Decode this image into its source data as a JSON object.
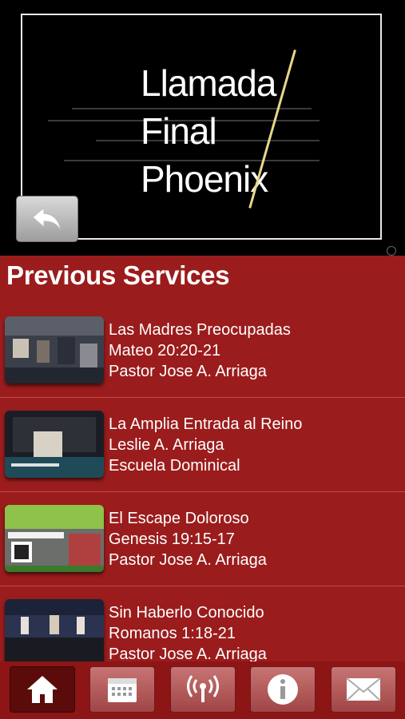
{
  "hero": {
    "title_lines": [
      "Llamada",
      "Final",
      "Phoenix"
    ]
  },
  "section": {
    "title": "Previous Services"
  },
  "services": [
    {
      "title": "Las Madres Preocupadas",
      "reference": "Mateo 20:20-21",
      "speaker": "Pastor Jose A. Arriaga"
    },
    {
      "title": "La Amplia Entrada al Reino",
      "reference": "Leslie A. Arriaga",
      "speaker": "Escuela Dominical"
    },
    {
      "title": "El Escape Doloroso",
      "reference": "Genesis 19:15-17",
      "speaker": "Pastor Jose A. Arriaga"
    },
    {
      "title": "Sin Haberlo Conocido",
      "reference": "Romanos 1:18-21",
      "speaker": "Pastor Jose A. Arriaga"
    }
  ],
  "tabs": [
    {
      "name": "home-icon"
    },
    {
      "name": "calendar-icon"
    },
    {
      "name": "broadcast-icon"
    },
    {
      "name": "info-icon"
    },
    {
      "name": "mail-icon"
    }
  ],
  "colors": {
    "background": "#9b1c1c",
    "tabbar": "#8d1515",
    "accent_line": "#e6d88a"
  }
}
